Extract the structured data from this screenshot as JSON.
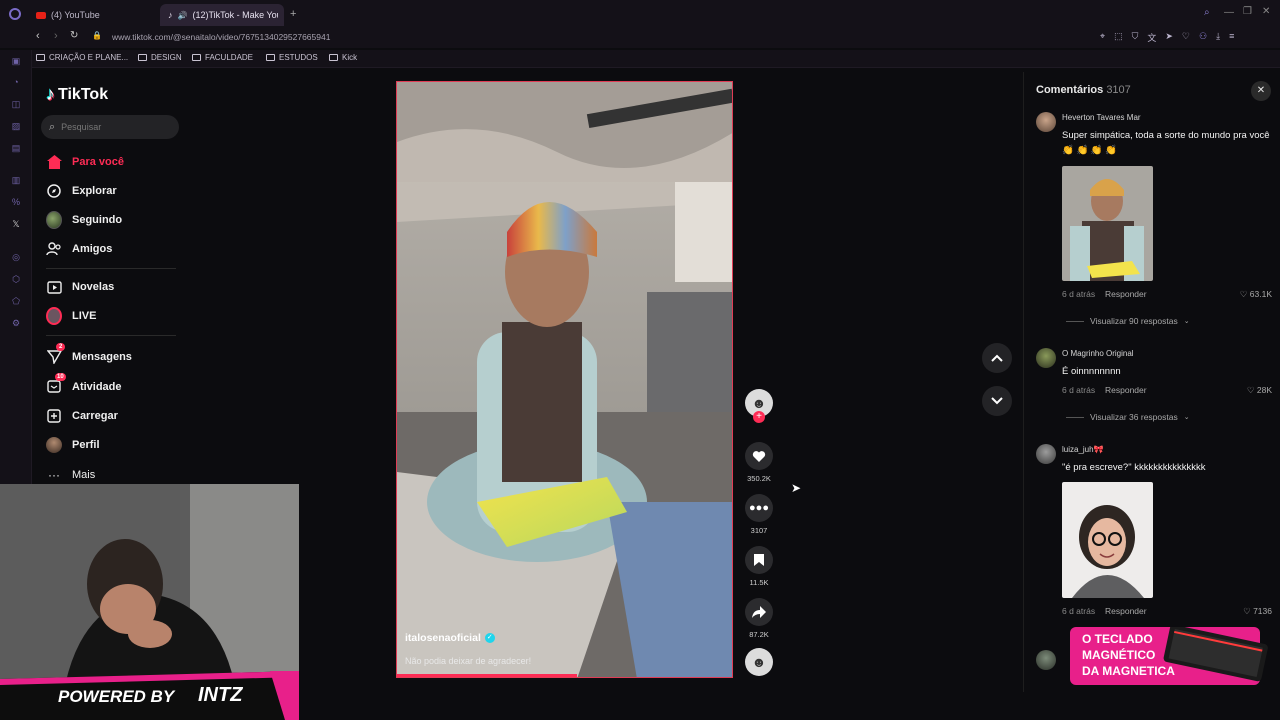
{
  "browser": {
    "tabs": [
      {
        "label": "(4) YouTube",
        "active": false
      },
      {
        "label": "(12)TikTok - Make Your",
        "active": true
      }
    ],
    "new_tab": "+",
    "url": "www.tiktok.com/@senaitalo/video/7675134029527665941",
    "bookmarks": [
      "CRIAÇÃO E PLANE...",
      "DESIGN",
      "FACULDADE",
      "ESTUDOS",
      "Kick"
    ]
  },
  "tiktok": {
    "logo": "TikTok",
    "search_placeholder": "Pesquisar",
    "nav": [
      {
        "label": "Para você",
        "icon": "home-icon",
        "active": true
      },
      {
        "label": "Explorar",
        "icon": "compass-icon"
      },
      {
        "label": "Seguindo",
        "icon": "following-avatar-icon"
      },
      {
        "label": "Amigos",
        "icon": "friends-icon"
      },
      {
        "label": "Novelas",
        "icon": "film-icon"
      },
      {
        "label": "LIVE",
        "icon": "live-icon"
      },
      {
        "label": "Mensagens",
        "icon": "send-icon",
        "badge": "2"
      },
      {
        "label": "Atividade",
        "icon": "inbox-icon",
        "badge": "10"
      },
      {
        "label": "Carregar",
        "icon": "upload-icon"
      },
      {
        "label": "Perfil",
        "icon": "profile-avatar-icon"
      },
      {
        "label": "Mais",
        "icon": "more-dots-icon"
      }
    ]
  },
  "video": {
    "username": "italosenaoficial",
    "caption": "Não podia deixar de agradecer!",
    "verified": true,
    "progress": 0.54
  },
  "actions": {
    "likes": "350.2K",
    "comments": "3107",
    "saves": "11.5K",
    "shares": "87.2K"
  },
  "comments_panel": {
    "title": "Comentários",
    "count": "3107",
    "reply_label": "Responder",
    "items": [
      {
        "user": "Heverton Tavares Mar",
        "text": "Super simpática, toda a sorte do mundo pra você 👏 👏 👏 👏",
        "time": "6 d atrás",
        "likes": "63.1K",
        "view_replies": "Visualizar 90 respostas"
      },
      {
        "user": "O Magrinho Original",
        "text": "É oinnnnnnnn",
        "time": "6 d atrás",
        "likes": "28K",
        "view_replies": "Visualizar 36 respostas"
      },
      {
        "user": "luiza_juh🎀",
        "text": "\"é pra escreve?\" kkkkkkkkkkkkkkk",
        "time": "6 d atrás",
        "likes": "7136"
      }
    ]
  },
  "overlay": {
    "powered_by": "POWERED BY",
    "brand": "INTZ",
    "ad_line1": "O TECLADO",
    "ad_line2": "MAGNÉTICO",
    "ad_line3": "DA MAGNETICA"
  },
  "colors": {
    "accent": "#fe2c55",
    "background": "#121212",
    "browser": "#141118"
  }
}
